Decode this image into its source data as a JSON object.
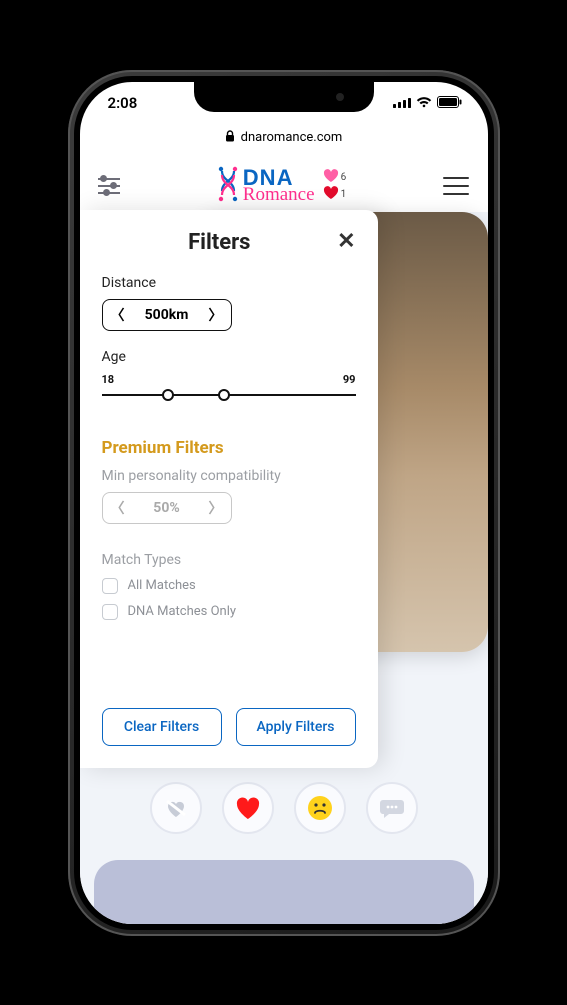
{
  "status": {
    "time": "2:08"
  },
  "browser": {
    "domain": "dnaromance.com"
  },
  "header": {
    "brand_top": "DNA",
    "brand_bottom": "Romance",
    "heart_counts": {
      "top": "6",
      "bottom": "1"
    }
  },
  "filters": {
    "title": "Filters",
    "distance_label": "Distance",
    "distance_value": "500km",
    "age_label": "Age",
    "age_min": "18",
    "age_max": "99",
    "premium_heading": "Premium Filters",
    "personality_label": "Min personality compatibility",
    "personality_value": "50%",
    "match_types_label": "Match Types",
    "match_option_all": "All Matches",
    "match_option_dna": "DNA Matches Only",
    "clear_label": "Clear Filters",
    "apply_label": "Apply Filters"
  }
}
